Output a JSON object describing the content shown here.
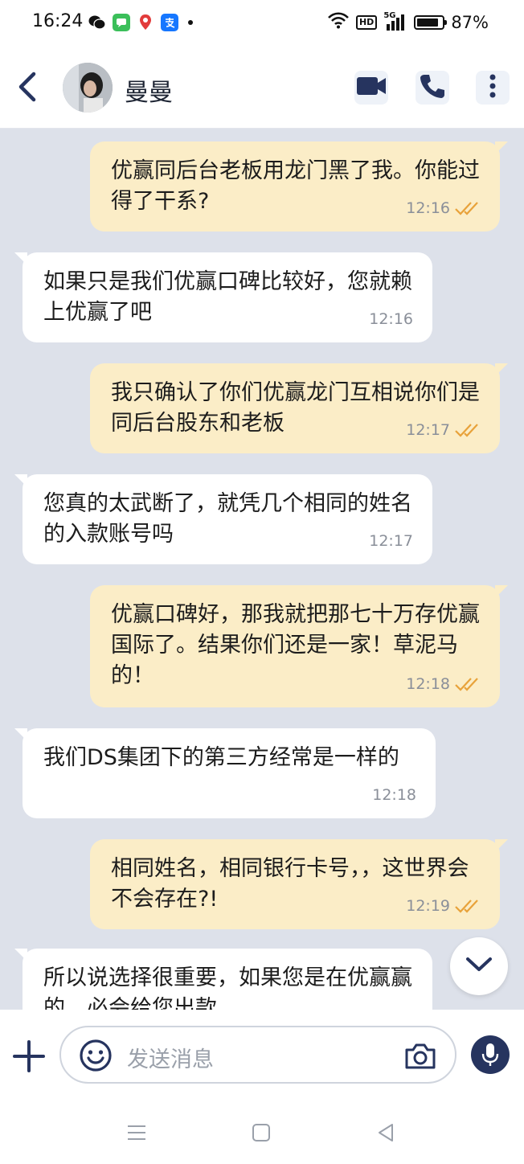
{
  "status_bar": {
    "time": "16:24",
    "app_icons": [
      "wechat-icon",
      "messages-icon",
      "maps-icon",
      "alipay-icon"
    ],
    "network_hd": "HD",
    "network_gen": "5G",
    "battery_level": 0.87,
    "battery_percent": "87%"
  },
  "header": {
    "contact_name": "曼曼",
    "actions": [
      "video-call-icon",
      "phone-icon",
      "more-options-icon"
    ]
  },
  "messages": [
    {
      "side": "out",
      "text": "优赢同后台老板用龙门黑了我。你能过得了干系?",
      "time": "12:16",
      "status": "read"
    },
    {
      "side": "in",
      "text": "如果只是我们优赢口碑比较好，您就赖上优赢了吧",
      "time": "12:16"
    },
    {
      "side": "out",
      "text": "我只确认了你们优赢龙门互相说你们是同后台股东和老板",
      "time": "12:17",
      "status": "read"
    },
    {
      "side": "in",
      "text": "您真的太武断了，就凭几个相同的姓名的入款账号吗",
      "time": "12:17"
    },
    {
      "side": "out",
      "text": "优赢口碑好，那我就把那七十万存优赢国际了。结果你们还是一家！草泥马的！",
      "time": "12:18",
      "status": "read"
    },
    {
      "side": "in",
      "text": "我们DS集团下的第三方经常是一样的",
      "time": "12:18"
    },
    {
      "side": "out",
      "text": "相同姓名，相同银行卡号，，这世界会不会存在?!",
      "time": "12:19",
      "status": "read"
    },
    {
      "side": "in",
      "text": "所以说选择很重要，如果您是在优赢赢的，必会给您出款",
      "time": ""
    }
  ],
  "input": {
    "placeholder": "发送消息"
  },
  "colors": {
    "outgoing_bubble": "#fbedc7",
    "incoming_bubble": "#ffffff",
    "chat_background": "#dde1ea",
    "accent": "#26345f",
    "read_ticks": "#e8a23a"
  }
}
